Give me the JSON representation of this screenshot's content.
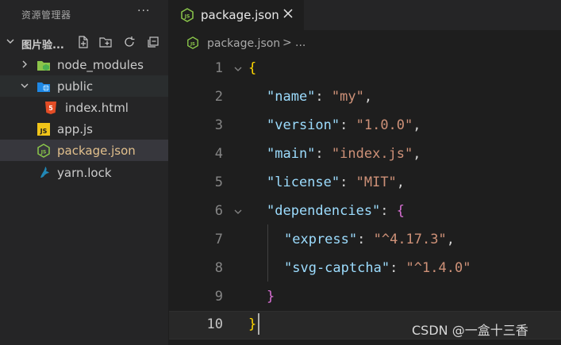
{
  "explorer": {
    "title": "资源管理器",
    "more_label": "···",
    "section_name": "图片验...",
    "items": [
      {
        "label": "node_modules",
        "color": "#cccccc"
      },
      {
        "label": "public",
        "color": "#e5e5e5"
      },
      {
        "label": "index.html",
        "color": "#cccccc"
      },
      {
        "label": "app.js",
        "color": "#cccccc"
      },
      {
        "label": "package.json",
        "color": "#e2c08d"
      },
      {
        "label": "yarn.lock",
        "color": "#cccccc"
      }
    ]
  },
  "editor": {
    "tab": {
      "label": "package.json",
      "icon": "nodejs-icon",
      "close": "close-icon"
    },
    "breadcrumb": {
      "file": "package.json",
      "separator": ">",
      "more": "..."
    },
    "line_numbers": [
      "1",
      "2",
      "3",
      "4",
      "5",
      "6",
      "7",
      "8",
      "9",
      "10"
    ],
    "lines": [
      {
        "tokens": [
          {
            "t": "{",
            "c": "b1"
          }
        ]
      },
      {
        "tokens": [
          {
            "t": "\"name\"",
            "c": "k"
          },
          {
            "t": ": ",
            "c": "p"
          },
          {
            "t": "\"my\"",
            "c": "s"
          },
          {
            "t": ",",
            "c": "p"
          }
        ]
      },
      {
        "tokens": [
          {
            "t": "\"version\"",
            "c": "k"
          },
          {
            "t": ": ",
            "c": "p"
          },
          {
            "t": "\"1.0.0\"",
            "c": "s"
          },
          {
            "t": ",",
            "c": "p"
          }
        ]
      },
      {
        "tokens": [
          {
            "t": "\"main\"",
            "c": "k"
          },
          {
            "t": ": ",
            "c": "p"
          },
          {
            "t": "\"index.js\"",
            "c": "s"
          },
          {
            "t": ",",
            "c": "p"
          }
        ]
      },
      {
        "tokens": [
          {
            "t": "\"license\"",
            "c": "k"
          },
          {
            "t": ": ",
            "c": "p"
          },
          {
            "t": "\"MIT\"",
            "c": "s"
          },
          {
            "t": ",",
            "c": "p"
          }
        ]
      },
      {
        "tokens": [
          {
            "t": "\"dependencies\"",
            "c": "k"
          },
          {
            "t": ": ",
            "c": "p"
          },
          {
            "t": "{",
            "c": "b2"
          }
        ]
      },
      {
        "tokens": [
          {
            "t": "\"express\"",
            "c": "k"
          },
          {
            "t": ": ",
            "c": "p"
          },
          {
            "t": "\"^4.17.3\"",
            "c": "s"
          },
          {
            "t": ",",
            "c": "p"
          }
        ]
      },
      {
        "tokens": [
          {
            "t": "\"svg-captcha\"",
            "c": "k"
          },
          {
            "t": ": ",
            "c": "p"
          },
          {
            "t": "\"^1.4.0\"",
            "c": "s"
          }
        ]
      },
      {
        "tokens": [
          {
            "t": "}",
            "c": "b2"
          }
        ]
      },
      {
        "tokens": [
          {
            "t": "}",
            "c": "b1"
          }
        ]
      }
    ],
    "active_line": "10"
  },
  "colors": {
    "accent_json": "#e2c08d",
    "key": "#9cdcfe",
    "string": "#ce9178",
    "bracket_outer": "#ffd700",
    "bracket_inner": "#da70d6"
  },
  "watermark": "CSDN @一盒十三香"
}
